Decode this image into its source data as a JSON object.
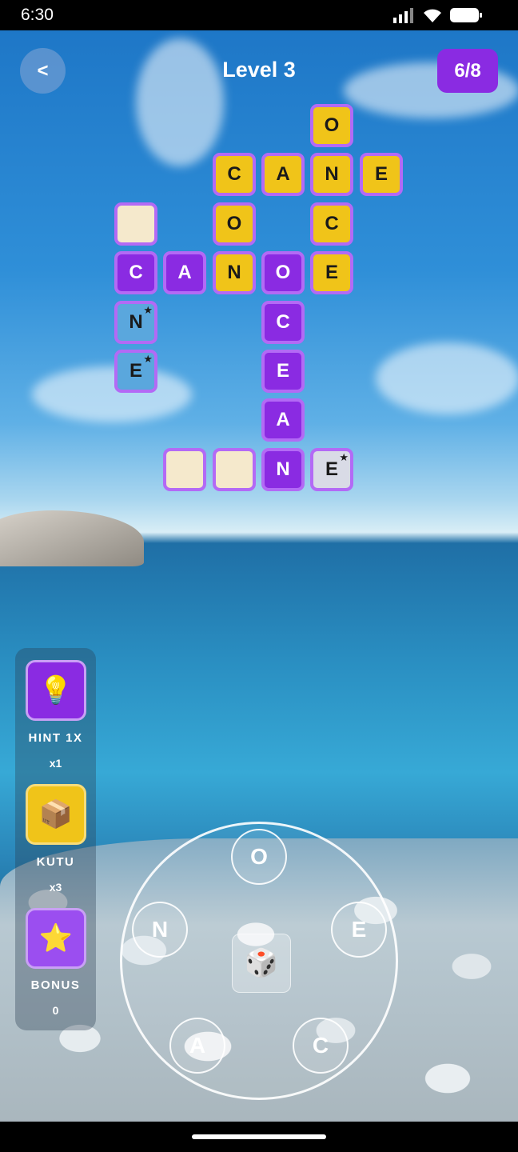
{
  "status_bar": {
    "time": "6:30"
  },
  "header": {
    "back_label": "<",
    "title": "Level 3",
    "progress": "6/8"
  },
  "grid": {
    "star_symbol": "★",
    "tiles": [
      {
        "letter": "O",
        "style": "yellow",
        "star": false
      },
      {
        "letter": "C",
        "style": "yellow",
        "star": false
      },
      {
        "letter": "A",
        "style": "yellow",
        "star": false
      },
      {
        "letter": "N",
        "style": "yellow",
        "star": false
      },
      {
        "letter": "E",
        "style": "yellow",
        "star": false
      },
      {
        "letter": "",
        "style": "empty",
        "star": false
      },
      {
        "letter": "O",
        "style": "yellow",
        "star": false
      },
      {
        "letter": "C",
        "style": "yellow",
        "star": false
      },
      {
        "letter": "C",
        "style": "purple",
        "star": false
      },
      {
        "letter": "A",
        "style": "purple",
        "star": false
      },
      {
        "letter": "N",
        "style": "yellow",
        "star": false
      },
      {
        "letter": "O",
        "style": "purple",
        "star": false
      },
      {
        "letter": "E",
        "style": "yellow",
        "star": false
      },
      {
        "letter": "N",
        "style": "blue",
        "star": true
      },
      {
        "letter": "C",
        "style": "purple",
        "star": false
      },
      {
        "letter": "E",
        "style": "blue",
        "star": true
      },
      {
        "letter": "E",
        "style": "purple",
        "star": false
      },
      {
        "letter": "A",
        "style": "purple",
        "star": false
      },
      {
        "letter": "",
        "style": "empty",
        "star": false
      },
      {
        "letter": "",
        "style": "empty",
        "star": false
      },
      {
        "letter": "N",
        "style": "purple",
        "star": false
      },
      {
        "letter": "E",
        "style": "grey",
        "star": true
      }
    ]
  },
  "tools": {
    "hint": {
      "icon": "lightbulb-icon",
      "label": "HINT 1X",
      "count": "x1"
    },
    "box": {
      "icon": "box-icon",
      "label": "KUTU",
      "count": "x3"
    },
    "bonus": {
      "icon": "star-icon",
      "label": "BONUS",
      "count": "0"
    }
  },
  "wheel": {
    "letters": [
      "O",
      "E",
      "C",
      "A",
      "N"
    ],
    "shuffle_icon": "dice-icon"
  },
  "colors": {
    "accent_purple": "#8a2be2",
    "tile_yellow": "#f0c419",
    "tile_border": "#b36af5"
  }
}
